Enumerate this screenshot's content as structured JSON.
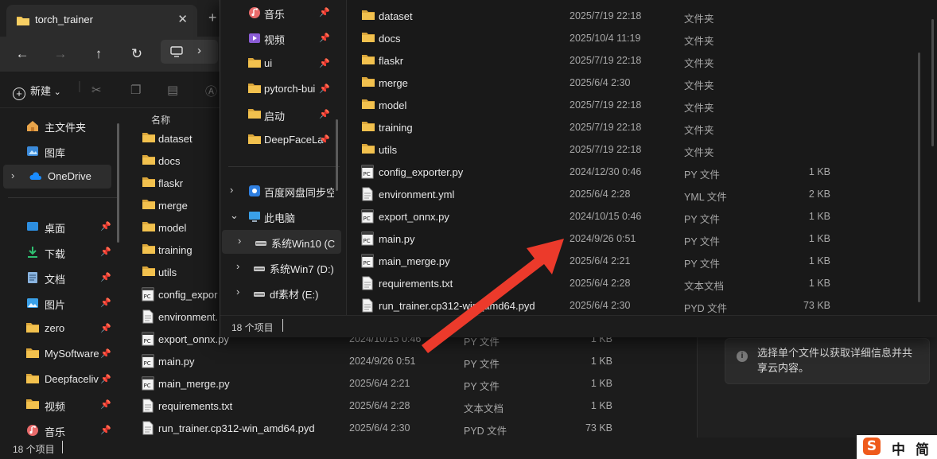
{
  "back_window": {
    "tab_title": "torch_trainer",
    "tab_close": "✕",
    "new_tab": "+",
    "toolbar": {
      "new_label": "新建",
      "new_chevron": "⌄"
    },
    "column_name": "名称",
    "sidebar": [
      {
        "label": "主文件夹",
        "icon": "home-icon",
        "pinned": false
      },
      {
        "label": "图库",
        "icon": "gallery-icon",
        "pinned": false
      },
      {
        "label": "OneDrive",
        "icon": "cloud-icon",
        "pinned": false,
        "selected": true,
        "chevron": "›"
      },
      {
        "label": "桌面",
        "icon": "desktop-icon",
        "pinned": true
      },
      {
        "label": "下载",
        "icon": "download-icon",
        "pinned": true
      },
      {
        "label": "文档",
        "icon": "document-icon",
        "pinned": true
      },
      {
        "label": "图片",
        "icon": "pictures-icon",
        "pinned": true
      },
      {
        "label": "zero",
        "icon": "folder-icon",
        "pinned": true
      },
      {
        "label": "MySoftware",
        "icon": "folder-icon",
        "pinned": true
      },
      {
        "label": "Deepfaceliv",
        "icon": "folder-icon",
        "pinned": true
      },
      {
        "label": "视频",
        "icon": "folder-icon",
        "pinned": true
      },
      {
        "label": "音乐",
        "icon": "music-icon",
        "pinned": true
      }
    ],
    "files": [
      {
        "name": "dataset",
        "kind": "folder",
        "date": "",
        "type": "",
        "size": ""
      },
      {
        "name": "docs",
        "kind": "folder",
        "date": "",
        "type": "",
        "size": ""
      },
      {
        "name": "flaskr",
        "kind": "folder",
        "date": "",
        "type": "",
        "size": ""
      },
      {
        "name": "merge",
        "kind": "folder",
        "date": "",
        "type": "",
        "size": ""
      },
      {
        "name": "model",
        "kind": "folder",
        "date": "",
        "type": "",
        "size": ""
      },
      {
        "name": "training",
        "kind": "folder",
        "date": "",
        "type": "",
        "size": ""
      },
      {
        "name": "utils",
        "kind": "folder",
        "date": "",
        "type": "",
        "size": ""
      },
      {
        "name": "config_expor",
        "kind": "py",
        "date": "",
        "type": "",
        "size": ""
      },
      {
        "name": "environment.",
        "kind": "txt",
        "date": "",
        "type": "",
        "size": ""
      },
      {
        "name": "export_onnx.py",
        "kind": "py",
        "date": "2024/10/15 0:46",
        "type": "PY 文件",
        "size": "1 KB"
      },
      {
        "name": "main.py",
        "kind": "py",
        "date": "2024/9/26 0:51",
        "type": "PY 文件",
        "size": "1 KB"
      },
      {
        "name": "main_merge.py",
        "kind": "py",
        "date": "2025/6/4 2:21",
        "type": "PY 文件",
        "size": "1 KB"
      },
      {
        "name": "requirements.txt",
        "kind": "txt",
        "date": "2025/6/4 2:28",
        "type": "文本文档",
        "size": "1 KB"
      },
      {
        "name": "run_trainer.cp312-win_amd64.pyd",
        "kind": "txt",
        "date": "2025/6/4 2:30",
        "type": "PYD 文件",
        "size": "73 KB"
      }
    ],
    "detail_text": "选择单个文件以获取详细信息并共享云内容。",
    "status_count": "18 个项目",
    "ime": {
      "logo": "S",
      "mode": "中",
      "script": "简"
    }
  },
  "front_window": {
    "sidebar": [
      {
        "label": "音乐",
        "icon": "music-icon",
        "pinned": true
      },
      {
        "label": "视频",
        "icon": "video-icon",
        "pinned": true
      },
      {
        "label": "ui",
        "icon": "folder-icon",
        "pinned": true
      },
      {
        "label": "pytorch-bui",
        "icon": "folder-icon",
        "pinned": true
      },
      {
        "label": "启动",
        "icon": "folder-icon",
        "pinned": true
      },
      {
        "label": "DeepFaceLa",
        "icon": "folder-icon",
        "pinned": true
      },
      {
        "label": "百度网盘同步空",
        "icon": "baidu-sync-icon",
        "chevron": "›"
      },
      {
        "label": "此电脑",
        "icon": "pc-icon",
        "chevron": "⌄"
      },
      {
        "label": "系统Win10 (C",
        "icon": "drive-icon",
        "chevron": "›",
        "selected": true
      },
      {
        "label": "系统Win7 (D:)",
        "icon": "drive-icon",
        "chevron": "›"
      },
      {
        "label": "df素材 (E:)",
        "icon": "drive-icon",
        "chevron": "›"
      }
    ],
    "files": [
      {
        "name": "dataset",
        "kind": "folder",
        "date": "2025/7/19 22:18",
        "type": "文件夹",
        "size": ""
      },
      {
        "name": "docs",
        "kind": "folder",
        "date": "2025/10/4 11:19",
        "type": "文件夹",
        "size": ""
      },
      {
        "name": "flaskr",
        "kind": "folder",
        "date": "2025/7/19 22:18",
        "type": "文件夹",
        "size": ""
      },
      {
        "name": "merge",
        "kind": "folder",
        "date": "2025/6/4 2:30",
        "type": "文件夹",
        "size": ""
      },
      {
        "name": "model",
        "kind": "folder",
        "date": "2025/7/19 22:18",
        "type": "文件夹",
        "size": ""
      },
      {
        "name": "training",
        "kind": "folder",
        "date": "2025/7/19 22:18",
        "type": "文件夹",
        "size": ""
      },
      {
        "name": "utils",
        "kind": "folder",
        "date": "2025/7/19 22:18",
        "type": "文件夹",
        "size": ""
      },
      {
        "name": "config_exporter.py",
        "kind": "py",
        "date": "2024/12/30 0:46",
        "type": "PY 文件",
        "size": "1 KB"
      },
      {
        "name": "environment.yml",
        "kind": "txt",
        "date": "2025/6/4 2:28",
        "type": "YML 文件",
        "size": "2 KB"
      },
      {
        "name": "export_onnx.py",
        "kind": "py",
        "date": "2024/10/15 0:46",
        "type": "PY 文件",
        "size": "1 KB"
      },
      {
        "name": "main.py",
        "kind": "py",
        "date": "2024/9/26 0:51",
        "type": "PY 文件",
        "size": "1 KB"
      },
      {
        "name": "main_merge.py",
        "kind": "py",
        "date": "2025/6/4 2:21",
        "type": "PY 文件",
        "size": "1 KB"
      },
      {
        "name": "requirements.txt",
        "kind": "txt",
        "date": "2025/6/4 2:28",
        "type": "文本文档",
        "size": "1 KB"
      },
      {
        "name": "run_trainer.cp312-win_amd64.pyd",
        "kind": "txt",
        "date": "2025/6/4 2:30",
        "type": "PYD 文件",
        "size": "73 KB"
      }
    ],
    "status_count": "18 个项目"
  },
  "colors": {
    "folder": "#f2c14e",
    "folder_dark": "#d9a53a",
    "arrow": "#ec3a2b",
    "accent": "#4cc2ff"
  }
}
